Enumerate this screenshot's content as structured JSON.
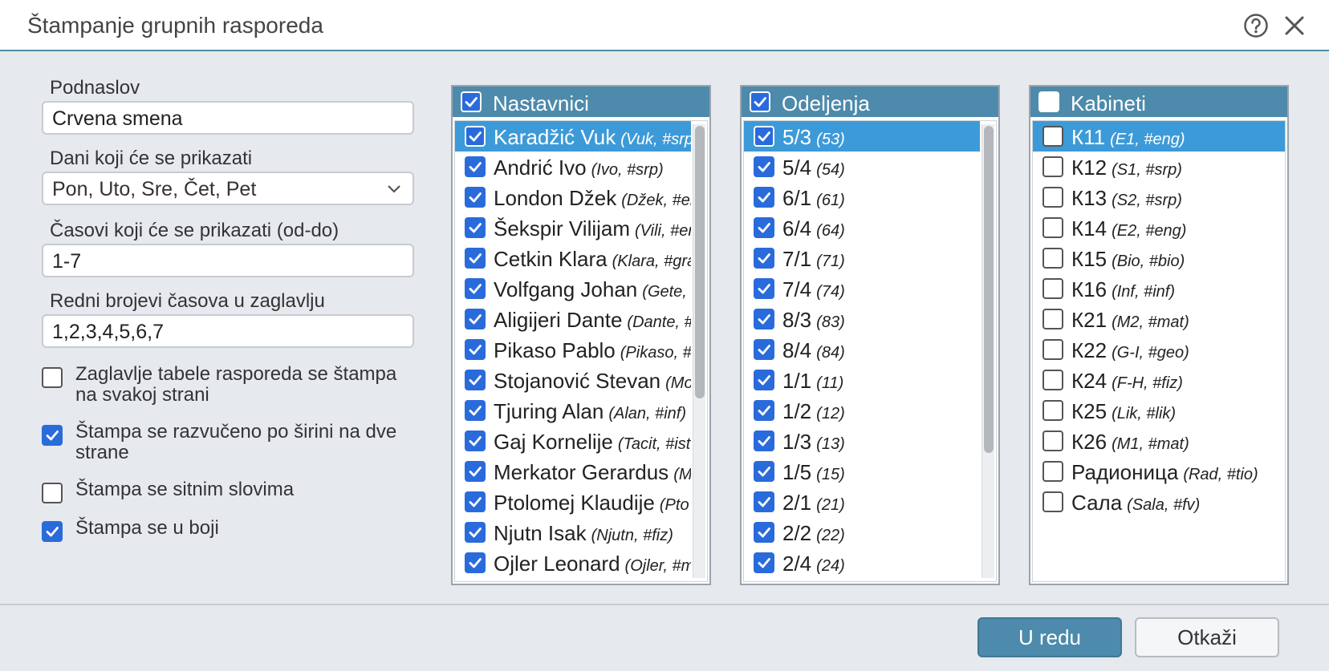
{
  "dialog": {
    "title": "Štampanje grupnih rasporeda",
    "help_icon": "help-circle-icon",
    "close_icon": "close-icon"
  },
  "form": {
    "subtitle_label": "Podnaslov",
    "subtitle_value": "Crvena smena",
    "days_label": "Dani koji će se prikazati",
    "days_value": "Pon, Uto, Sre, Čet, Pet",
    "hours_label": "Časovi koji će se prikazati (od-do)",
    "hours_value": "1-7",
    "numbers_label": "Redni brojevi časova u zaglavlju",
    "numbers_value": "1,2,3,4,5,6,7"
  },
  "options": [
    {
      "label": "Zaglavlje tabele rasporeda se štampa na svakoj strani",
      "checked": false
    },
    {
      "label": "Štampa se razvučeno po širini na dve strane",
      "checked": true
    },
    {
      "label": "Štampa se sitnim slovima",
      "checked": false
    },
    {
      "label": "Štampa se u boji",
      "checked": true
    }
  ],
  "panels": [
    {
      "title": "Nastavnici",
      "checked": true,
      "scroll_thumb_fraction": 0.6,
      "items": [
        {
          "name": "Karadžić Vuk",
          "extra": "(Vuk, #srp)",
          "checked": true,
          "selected": true
        },
        {
          "name": "Andrić Ivo",
          "extra": "(Ivo, #srp)",
          "checked": true
        },
        {
          "name": "London Džek",
          "extra": "(Džek, #en",
          "checked": true
        },
        {
          "name": "Šekspir Vilijam",
          "extra": "(Vili, #en",
          "checked": true
        },
        {
          "name": "Cetkin Klara",
          "extra": "(Klara, #gra",
          "checked": true
        },
        {
          "name": "Volfgang Johan",
          "extra": "(Gete, #",
          "checked": true
        },
        {
          "name": "Aligijeri Dante",
          "extra": "(Dante, #",
          "checked": true
        },
        {
          "name": "Pikaso Pablo",
          "extra": "(Pikaso, #",
          "checked": true
        },
        {
          "name": "Stojanović Stevan",
          "extra": "(Mo",
          "checked": true
        },
        {
          "name": "Tjuring Alan",
          "extra": "(Alan, #inf)",
          "checked": true
        },
        {
          "name": "Gaj Kornelije",
          "extra": "(Tacit, #ist",
          "checked": true
        },
        {
          "name": "Merkator Gerardus",
          "extra": "(Me",
          "checked": true
        },
        {
          "name": "Ptolomej Klaudije",
          "extra": "(Pto",
          "checked": true
        },
        {
          "name": "Njutn Isak",
          "extra": "(Njutn, #fiz)",
          "checked": true
        },
        {
          "name": "Ojler Leonard",
          "extra": "(Ojler, #m",
          "checked": true
        }
      ]
    },
    {
      "title": "Odeljenja",
      "checked": true,
      "scroll_thumb_fraction": 0.72,
      "items": [
        {
          "name": "5/3",
          "extra": "(53)",
          "checked": true,
          "selected": true
        },
        {
          "name": "5/4",
          "extra": "(54)",
          "checked": true
        },
        {
          "name": "6/1",
          "extra": "(61)",
          "checked": true
        },
        {
          "name": "6/4",
          "extra": "(64)",
          "checked": true
        },
        {
          "name": "7/1",
          "extra": "(71)",
          "checked": true
        },
        {
          "name": "7/4",
          "extra": "(74)",
          "checked": true
        },
        {
          "name": "8/3",
          "extra": "(83)",
          "checked": true
        },
        {
          "name": "8/4",
          "extra": "(84)",
          "checked": true
        },
        {
          "name": "1/1",
          "extra": "(11)",
          "checked": true
        },
        {
          "name": "1/2",
          "extra": "(12)",
          "checked": true
        },
        {
          "name": "1/3",
          "extra": "(13)",
          "checked": true
        },
        {
          "name": "1/5",
          "extra": "(15)",
          "checked": true
        },
        {
          "name": "2/1",
          "extra": "(21)",
          "checked": true
        },
        {
          "name": "2/2",
          "extra": "(22)",
          "checked": true
        },
        {
          "name": "2/4",
          "extra": "(24)",
          "checked": true
        }
      ]
    },
    {
      "title": "Kabineti",
      "checked": false,
      "scroll_thumb_fraction": 0,
      "items": [
        {
          "name": "К11",
          "extra": "(E1, #eng)",
          "checked": false,
          "selected": true
        },
        {
          "name": "К12",
          "extra": "(S1, #srp)",
          "checked": false
        },
        {
          "name": "К13",
          "extra": "(S2, #srp)",
          "checked": false
        },
        {
          "name": "К14",
          "extra": "(E2, #eng)",
          "checked": false
        },
        {
          "name": "К15",
          "extra": "(Bio, #bio)",
          "checked": false
        },
        {
          "name": "К16",
          "extra": "(Inf, #inf)",
          "checked": false
        },
        {
          "name": "К21",
          "extra": "(M2, #mat)",
          "checked": false
        },
        {
          "name": "К22",
          "extra": "(G-I, #geo)",
          "checked": false
        },
        {
          "name": "К24",
          "extra": "(F-H, #fiz)",
          "checked": false
        },
        {
          "name": "К25",
          "extra": "(Lik, #lik)",
          "checked": false
        },
        {
          "name": "К26",
          "extra": "(M1, #mat)",
          "checked": false
        },
        {
          "name": "Радионица",
          "extra": "(Rad, #tio)",
          "checked": false
        },
        {
          "name": "Сала",
          "extra": "(Sala, #fv)",
          "checked": false
        }
      ]
    }
  ],
  "buttons": {
    "ok": "U redu",
    "cancel": "Otkaži"
  },
  "colors": {
    "accent": "#4d8aab",
    "check": "#2a6bdc",
    "selection": "#3d9ad8"
  }
}
